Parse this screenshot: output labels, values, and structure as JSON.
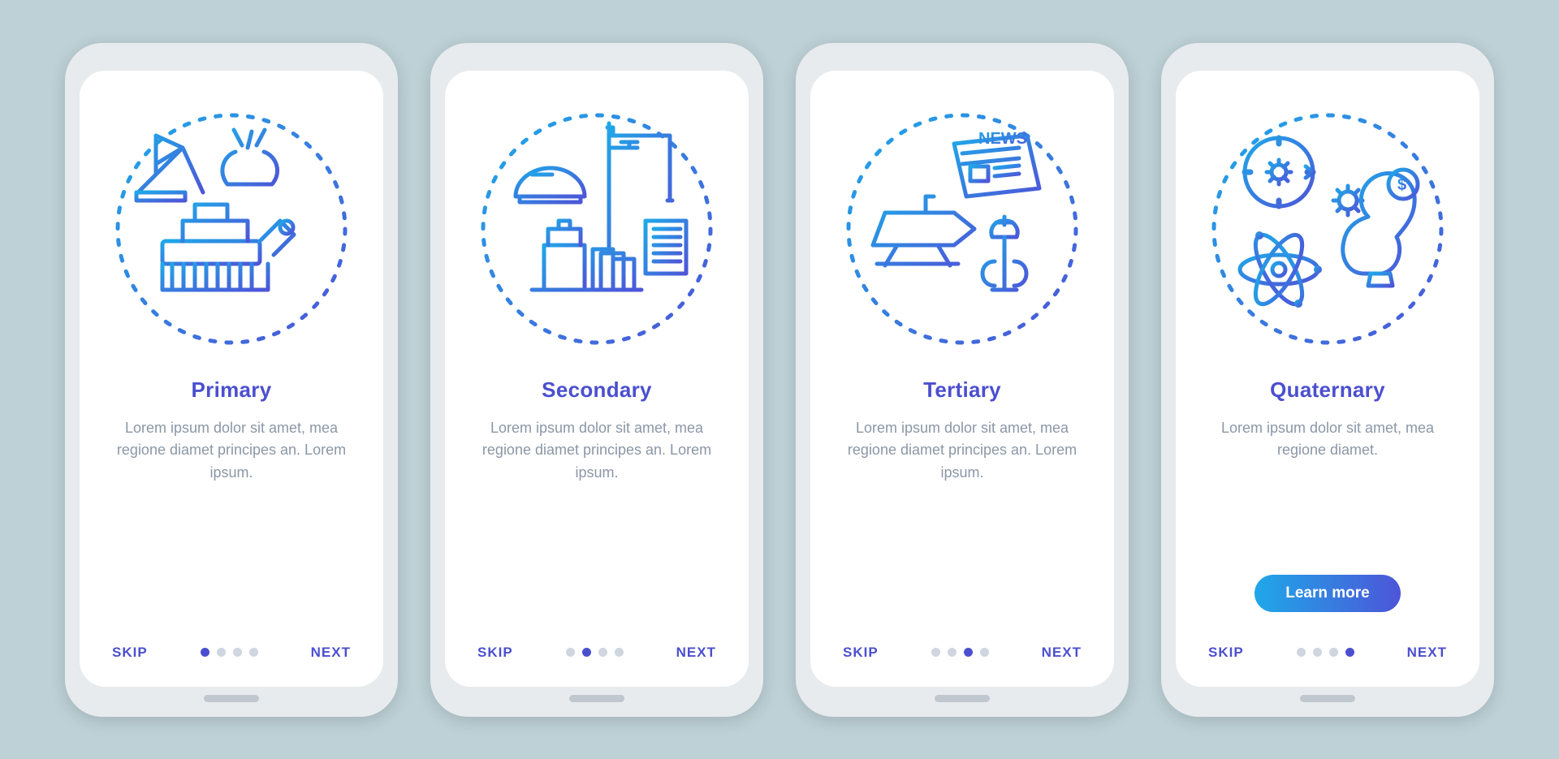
{
  "screens": [
    {
      "title": "Primary",
      "desc": "Lorem ipsum dolor sit amet, mea regione diamet principes an. Lorem ipsum.",
      "skip": "SKIP",
      "next": "NEXT",
      "active": 0,
      "cta": null,
      "icon": "primary"
    },
    {
      "title": "Secondary",
      "desc": "Lorem ipsum dolor sit amet, mea regione diamet principes an. Lorem ipsum.",
      "skip": "SKIP",
      "next": "NEXT",
      "active": 1,
      "cta": null,
      "icon": "secondary"
    },
    {
      "title": "Tertiary",
      "desc": "Lorem ipsum dolor sit amet, mea regione diamet principes an. Lorem ipsum.",
      "skip": "SKIP",
      "next": "NEXT",
      "active": 2,
      "cta": null,
      "icon": "tertiary"
    },
    {
      "title": "Quaternary",
      "desc": "Lorem ipsum dolor sit amet, mea regione diamet.",
      "skip": "SKIP",
      "next": "NEXT",
      "active": 3,
      "cta": "Learn more",
      "icon": "quaternary"
    }
  ],
  "dotCount": 4
}
